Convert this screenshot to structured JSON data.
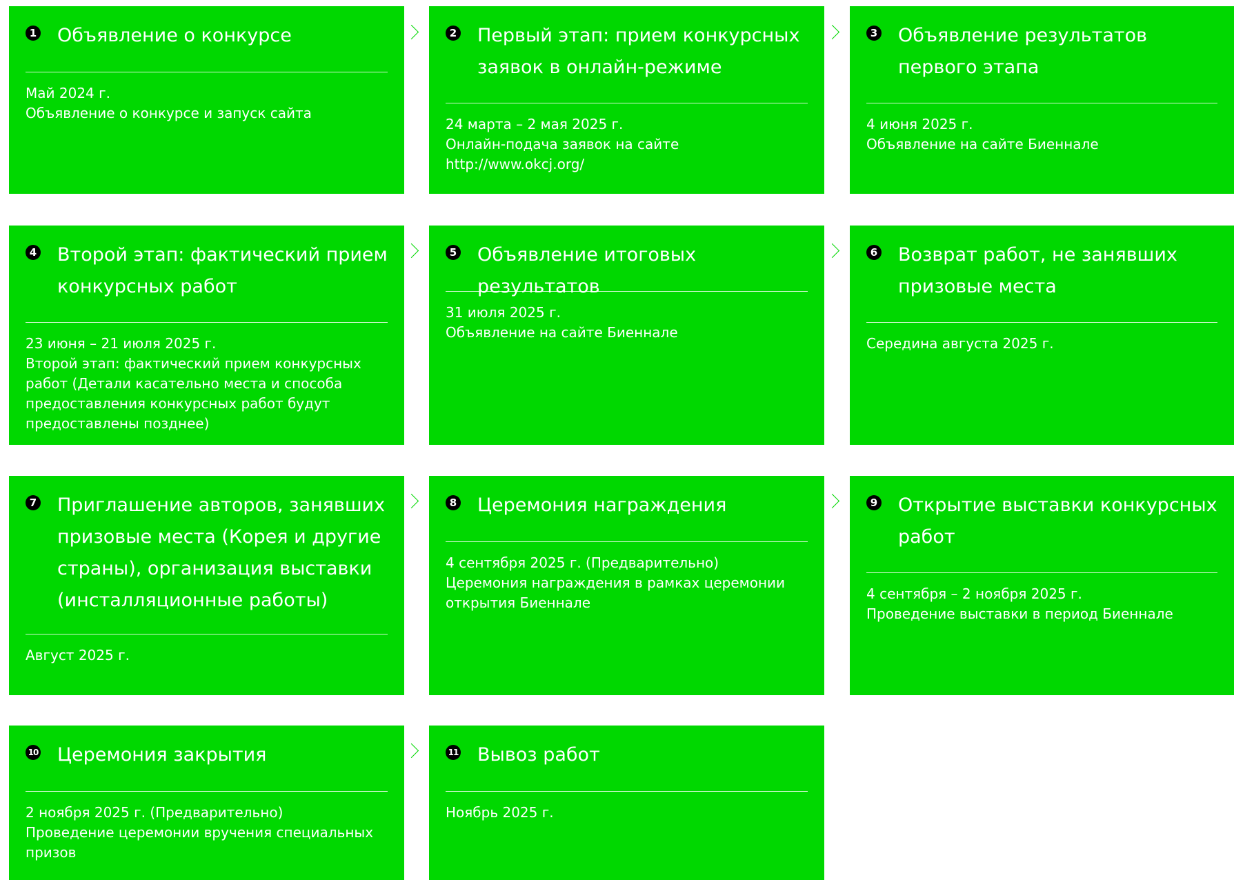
{
  "colors": {
    "card_bg": "#00d800",
    "text": "#ffffff",
    "arrow": "#00d800"
  },
  "steps": [
    {
      "num": "1",
      "title": "Объявление о конкурсе",
      "date": "Май 2024 г.",
      "lines": [
        "Объявление о конкурсе и запуск сайта"
      ]
    },
    {
      "num": "2",
      "title": "Первый этап: прием конкурсных заявок в онлайн-режиме",
      "date": "24 марта – 2 мая 2025 г.",
      "lines": [
        "Онлайн-подача заявок на сайте",
        "http://www.okcj.org/"
      ]
    },
    {
      "num": "3",
      "title": "Объявление результатов первого этапа",
      "date": "4 июня 2025 г.",
      "lines": [
        "Объявление на сайте Биеннале"
      ]
    },
    {
      "num": "4",
      "title": "Второй этап: фактический прием конкурсных работ",
      "date": "23 июня – 21 июля 2025 г.",
      "lines": [
        "Второй этап: фактический прием конкурсных работ (Детали касательно места и способа предоставления конкурсных работ будут предоставлены позднее)"
      ]
    },
    {
      "num": "5",
      "title": "Объявление итоговых результатов",
      "date": "31 июля 2025 г.",
      "lines": [
        "Объявление на сайте Биеннале"
      ]
    },
    {
      "num": "6",
      "title": "Возврат работ, не занявших призовые места",
      "date": "Середина августа 2025 г.",
      "lines": []
    },
    {
      "num": "7",
      "title": "Приглашение авторов, занявших призовые места (Корея и другие страны), организация выставки (инсталляционные работы)",
      "date": "Август 2025 г.",
      "lines": []
    },
    {
      "num": "8",
      "title": "Церемония награждения",
      "date": "4 сентября 2025 г. (Предварительно)",
      "lines": [
        "Церемония награждения в рамках церемонии открытия Биеннале"
      ]
    },
    {
      "num": "9",
      "title": "Открытие выставки конкурсных работ",
      "date": "4 сентября – 2 ноября 2025 г.",
      "lines": [
        "Проведение выставки в период Биеннале"
      ]
    },
    {
      "num": "10",
      "title": "Церемония закрытия",
      "date": "2 ноября 2025 г. (Предварительно)",
      "lines": [
        "Проведение церемонии вручения специальных призов"
      ]
    },
    {
      "num": "11",
      "title": "Вывоз работ",
      "date": "Ноябрь 2025 г.",
      "lines": []
    }
  ]
}
